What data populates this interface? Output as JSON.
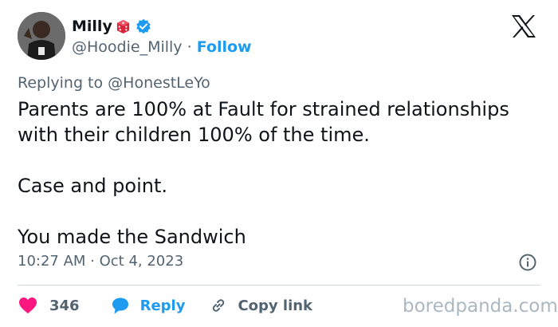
{
  "author": {
    "display_name": "Milly",
    "handle": "@Hoodie_Milly",
    "separator": "·",
    "follow_label": "Follow"
  },
  "reply_context": {
    "prefix": "Replying to",
    "mention": "@HonestLeYo"
  },
  "tweet": {
    "lines": [
      "Parents are 100% at Fault for strained relationships with their children 100% of the time.",
      "Case and point.",
      "You made the Sandwich"
    ],
    "timestamp": "10:27 AM · Oct 4, 2023"
  },
  "actions": {
    "like_count": "346",
    "reply_label": "Reply",
    "copy_link_label": "Copy link"
  },
  "watermark": "boredpanda.com",
  "colors": {
    "accent_blue": "#1d9bf0",
    "heart_pink": "#f91880",
    "text_primary": "#0f1419",
    "text_secondary": "#536471",
    "divider": "#cfd9de"
  },
  "icons": {
    "brand": "x-logo-icon",
    "badge": "verified-badge-icon",
    "emoji": "dice-emoji-icon",
    "info": "info-icon",
    "like": "heart-icon",
    "reply": "reply-bubble-icon",
    "copy": "link-icon"
  }
}
